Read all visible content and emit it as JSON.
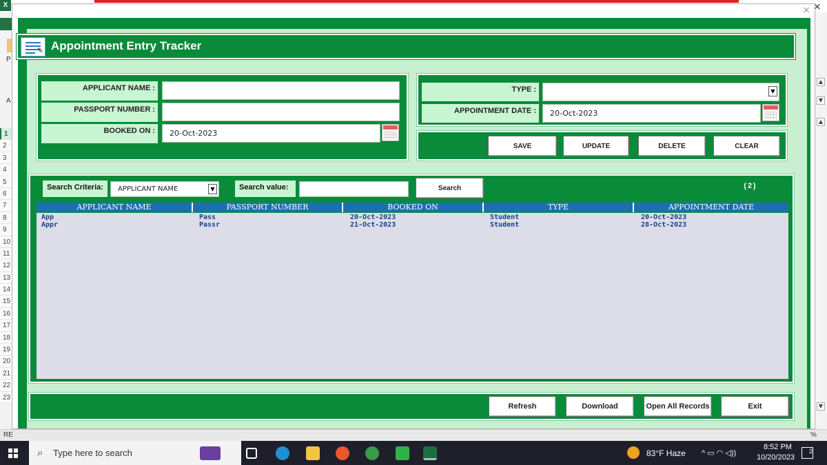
{
  "excel": {
    "logo": "X",
    "letter_p": "P",
    "letter_a": "A",
    "row_numbers": [
      "1",
      "2",
      "3",
      "4",
      "5",
      "6",
      "7",
      "8",
      "9",
      "10",
      "11",
      "12",
      "13",
      "14",
      "15",
      "16",
      "17",
      "18",
      "19",
      "20",
      "21",
      "22",
      "23"
    ],
    "status_left": "RE",
    "status_right": "%",
    "close": "×"
  },
  "form": {
    "title": "Appointment Entry Tracker",
    "close": "×",
    "fields": {
      "applicant_name_label": "APPLICANT NAME :",
      "applicant_name_value": "",
      "passport_number_label": "PASSPORT NUMBER :",
      "passport_number_value": "",
      "booked_on_label": "BOOKED ON :",
      "booked_on_value": "20-Oct-2023",
      "type_label": "TYPE :",
      "type_value": "",
      "appointment_date_label": "APPOINTMENT DATE :",
      "appointment_date_value": "20-Oct-2023"
    },
    "actions": {
      "save": "SAVE",
      "update": "UPDATE",
      "delete": "DELETE",
      "clear": "CLEAR"
    },
    "search": {
      "criteria_label": "Search Criteria:",
      "criteria_value": "APPLICANT NAME",
      "value_label": "Search value:",
      "value_input": "",
      "button": "Search",
      "count": "(2)"
    },
    "list": {
      "columns": [
        "APPLICANT NAME",
        "PASSPORT NUMBER",
        "BOOKED ON",
        "TYPE",
        "APPOINTMENT DATE"
      ],
      "rows": [
        [
          "App",
          "Pass",
          "20-Oct-2023",
          "Student",
          "20-Oct-2023"
        ],
        [
          "Appr",
          "Passr",
          "21-Oct-2023",
          "Student",
          "28-Oct-2023"
        ]
      ]
    },
    "footer": {
      "refresh": "Refresh",
      "download": "Download",
      "open_all": "Open All Records",
      "exit": "Exit"
    }
  },
  "taskbar": {
    "search_placeholder": "Type here to search",
    "weather": "83°F  Haze",
    "time": "8:52 PM",
    "date": "10/20/2023",
    "notifications": "2",
    "tray_icons": "^ ▭ ◠ ◁))"
  },
  "colors": {
    "form_green": "#098b3a",
    "light_green": "#c8f5d2",
    "header_blue": "#1c6fb0",
    "list_bg": "#dcdde8",
    "text_blue": "#1a3f8a"
  }
}
